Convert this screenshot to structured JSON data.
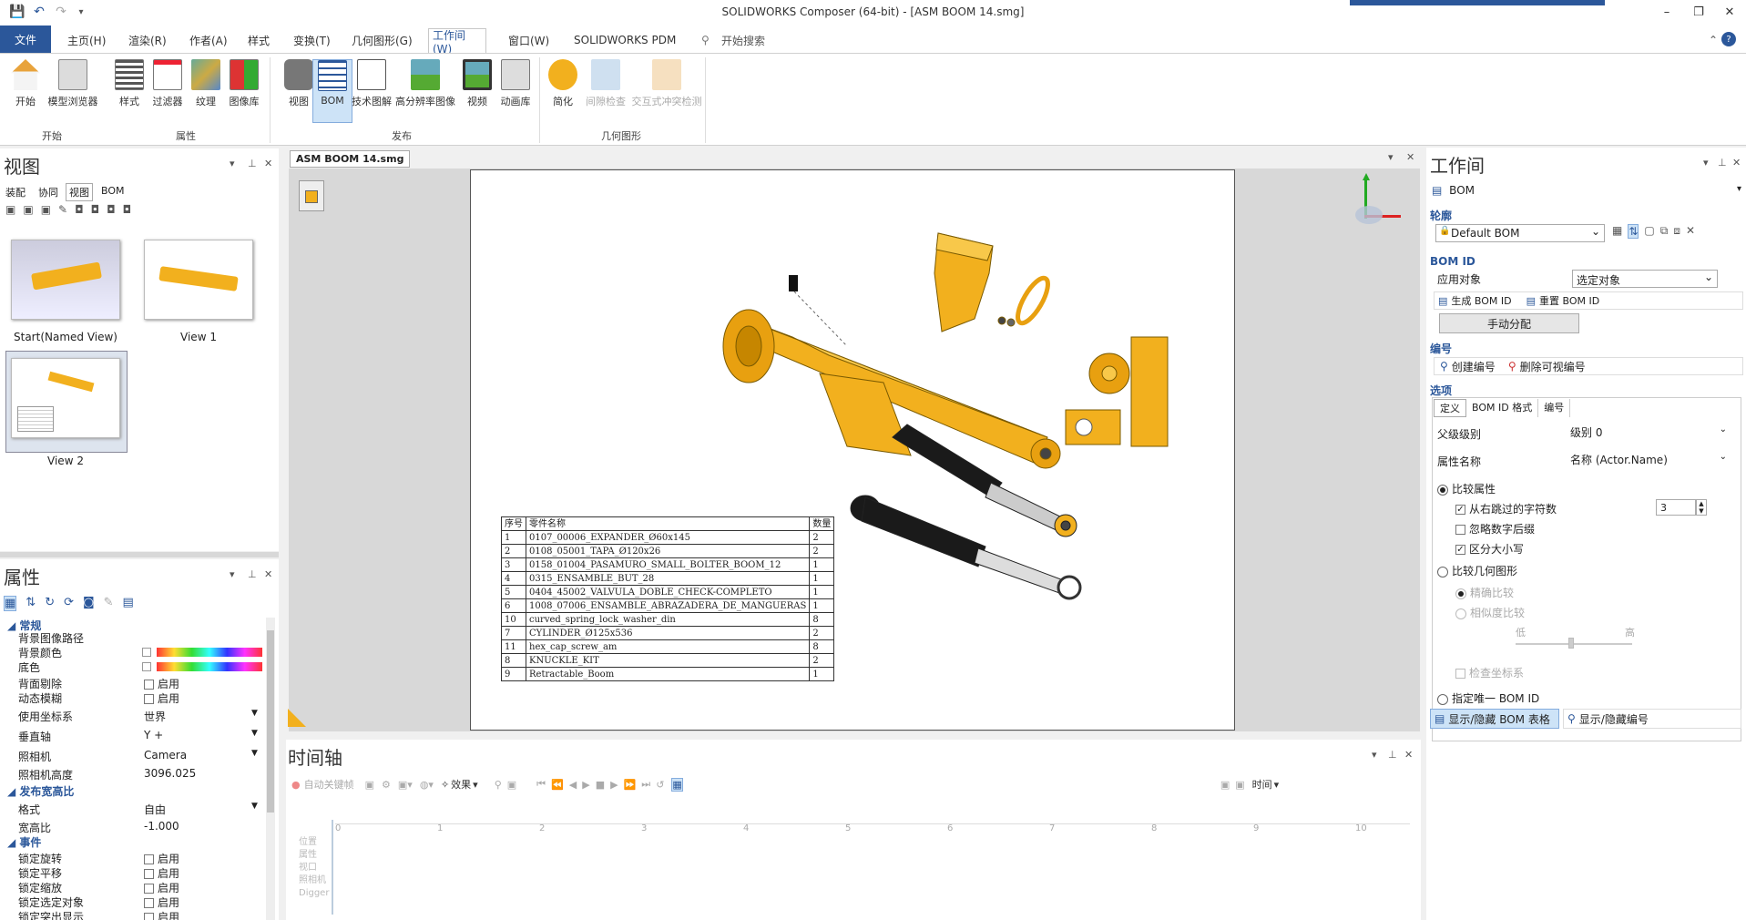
{
  "window": {
    "title": "SOLIDWORKS Composer (64-bit) - [ASM BOOM 14.smg]"
  },
  "menu": {
    "file": "文件",
    "tabs": [
      "主页(H)",
      "渲染(R)",
      "作者(A)",
      "样式",
      "变换(T)",
      "几何图形(G)",
      "工作间(W)",
      "窗口(W)",
      "SOLIDWORKS PDM"
    ],
    "active_tab": "工作间(W)",
    "search": "开始搜索"
  },
  "ribbon": {
    "buttons": [
      "开始",
      "模型浏览器",
      "样式",
      "过滤器",
      "纹理",
      "图像库",
      "视图",
      "BOM",
      "技术图解",
      "高分辨率图像",
      "视频",
      "动画库",
      "简化",
      "间隙检查",
      "交互式冲突检测"
    ],
    "groups": [
      "开始",
      "属性",
      "发布",
      "几何图形"
    ]
  },
  "left_panel": {
    "title": "视图",
    "tabs": [
      "装配",
      "协同",
      "视图",
      "BOM"
    ],
    "views": [
      "Start(Named View)",
      "View 1",
      "View 2"
    ]
  },
  "properties": {
    "title": "属性",
    "sections": [
      "常规",
      "发布宽高比",
      "事件"
    ],
    "rows": {
      "bg_image": "背景图像路径",
      "bg_color": "背景颜色",
      "floor": "底色",
      "backface": "背面剔除",
      "motion_blur": "动态模糊",
      "use_coord": "使用坐标系",
      "use_coord_val": "世界",
      "vertical_axis": "垂直轴",
      "vertical_axis_val": "Y +",
      "camera": "照相机",
      "camera_val": "Camera",
      "camera_height": "照相机高度",
      "camera_height_val": "3096.025",
      "format": "格式",
      "format_val": "自由",
      "ratio": "宽高比",
      "ratio_val": "-1.000",
      "lock_rotate": "锁定旋转",
      "lock_pan": "锁定平移",
      "lock_zoom": "锁定缩放",
      "lock_select": "锁定选定对象",
      "lock_highlight": "锁定突出显示",
      "enable": "启用"
    }
  },
  "document": {
    "tab": "ASM BOOM 14.smg"
  },
  "bom_table": {
    "headers": [
      "序号",
      "零件名称",
      "数量"
    ],
    "rows": [
      [
        "1",
        "0107_00006_EXPANDER_Ø60x145",
        "2"
      ],
      [
        "2",
        "0108_05001_TAPA_Ø120x26",
        "2"
      ],
      [
        "3",
        "0158_01004_PASAMURO_SMALL_BOLTER_BOOM_12",
        "1"
      ],
      [
        "4",
        "0315_ENSAMBLE_BUT_28",
        "1"
      ],
      [
        "5",
        "0404_45002_VALVULA_DOBLE_CHECK-COMPLETO",
        "1"
      ],
      [
        "6",
        "1008_07006_ENSAMBLE_ABRAZADERA_DE_MANGUERAS",
        "1"
      ],
      [
        "10",
        "curved_spring_lock_washer_din",
        "8"
      ],
      [
        "7",
        "CYLINDER_Ø125x536",
        "2"
      ],
      [
        "11",
        "hex_cap_screw_am",
        "8"
      ],
      [
        "8",
        "KNUCKLE_KIT",
        "2"
      ],
      [
        "9",
        "Retractable_Boom",
        "1"
      ]
    ]
  },
  "timeline": {
    "title": "时间轴",
    "autokey": "自动关键帧",
    "effects": "效果",
    "time": "时间",
    "ticks": [
      "0",
      "1",
      "2",
      "3",
      "4",
      "5",
      "6",
      "7",
      "8",
      "9",
      "10"
    ],
    "tracks": [
      "位置",
      "属性",
      "视口",
      "照相机",
      "Digger"
    ]
  },
  "workshop": {
    "title": "工作间",
    "selector": "BOM",
    "profile_label": "轮廓",
    "profile_value": "Default BOM",
    "bomid_label": "BOM ID",
    "apply_to": "应用对象",
    "apply_to_val": "选定对象",
    "generate": "生成 BOM ID",
    "reset": "重置 BOM ID",
    "manual": "手动分配",
    "numbering_label": "编号",
    "create_num": "创建编号",
    "delete_num": "删除可视编号",
    "options_label": "选项",
    "option_tabs": [
      "定义",
      "BOM ID 格式",
      "编号"
    ],
    "parent_level": "父级级别",
    "parent_level_val": "级别 0",
    "attr_name": "属性名称",
    "attr_name_val": "名称 (Actor.Name)",
    "compare_attr": "比较属性",
    "skip_chars": "从右跳过的字符数",
    "skip_val": "3",
    "ignore_suffix": "忽略数字后缀",
    "case_sensitive": "区分大小写",
    "compare_geom": "比较几何图形",
    "exact": "精确比较",
    "similar": "相似度比较",
    "low": "低",
    "high": "高",
    "check_coord": "检查坐标系",
    "unique_id": "指定唯一 BOM ID",
    "show_bom": "显示/隐藏 BOM 表格",
    "show_num": "显示/隐藏编号"
  },
  "colors": {
    "accent": "#2b579a",
    "part": "#f2b01e"
  }
}
